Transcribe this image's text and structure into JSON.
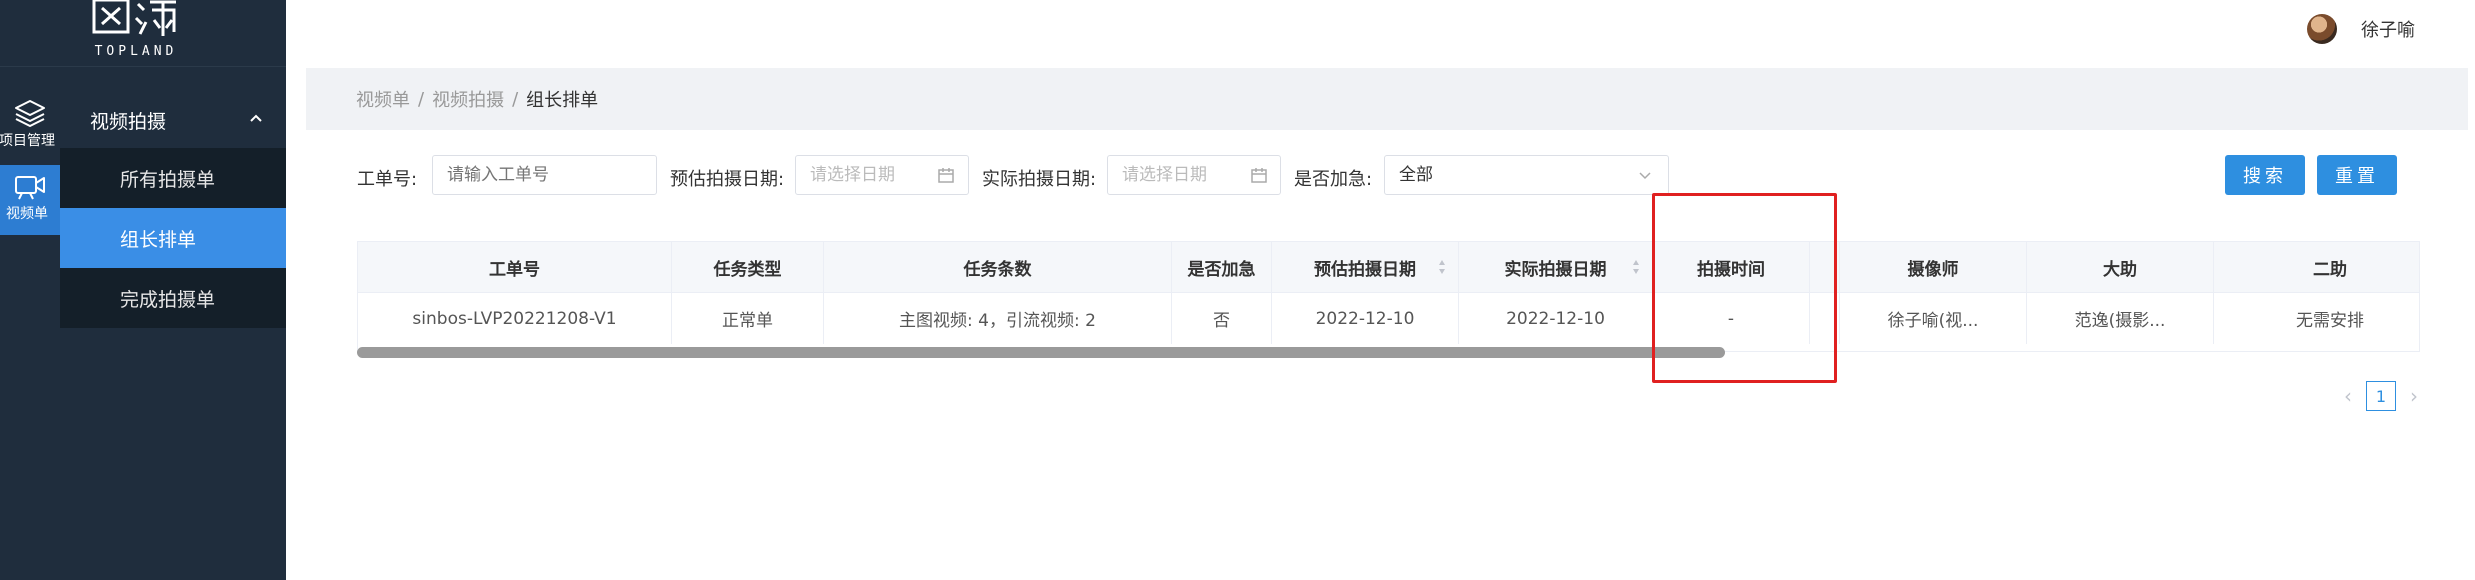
{
  "brand": {
    "logo_text": "TOPLAND"
  },
  "rail": {
    "items": [
      {
        "label": "项目管理",
        "icon": "layers-icon"
      },
      {
        "label": "视频单",
        "icon": "video-camera-icon"
      }
    ]
  },
  "submenu": {
    "title": "视频拍摄",
    "items": [
      {
        "label": "所有拍摄单"
      },
      {
        "label": "组长排单",
        "active": true
      },
      {
        "label": "完成拍摄单"
      }
    ]
  },
  "user": {
    "name": "徐子喻"
  },
  "breadcrumb": {
    "item1": "视频单",
    "item2": "视频拍摄",
    "current": "组长排单",
    "separator": "/"
  },
  "filters": {
    "order_no_label": "工单号:",
    "order_no_placeholder": "请输入工单号",
    "est_date_label": "预估拍摄日期:",
    "est_date_placeholder": "请选择日期",
    "actual_date_label": "实际拍摄日期:",
    "actual_date_placeholder": "请选择日期",
    "urgent_label": "是否加急:",
    "urgent_value": "全部"
  },
  "buttons": {
    "search": "搜索",
    "reset": "重置"
  },
  "table": {
    "columns": [
      "工单号",
      "任务类型",
      "任务条数",
      "是否加急",
      "预估拍摄日期",
      "实际拍摄日期",
      "拍摄时间",
      "",
      "摄像师",
      "大助",
      "二助"
    ],
    "rows": [
      [
        "sinbos-LVP20221208-V1",
        "正常单",
        "主图视频: 4，引流视频: 2",
        "否",
        "2022-12-10",
        "2022-12-10",
        "-",
        "",
        "徐子喻(视...",
        "范逸(摄影...",
        "无需安排"
      ]
    ]
  },
  "pagination": {
    "current_page": "1",
    "prev": "‹",
    "next": "›"
  },
  "colors": {
    "accent": "#2e8fe0",
    "sidebar": "#1f2d3d",
    "highlight": "#e02020"
  }
}
